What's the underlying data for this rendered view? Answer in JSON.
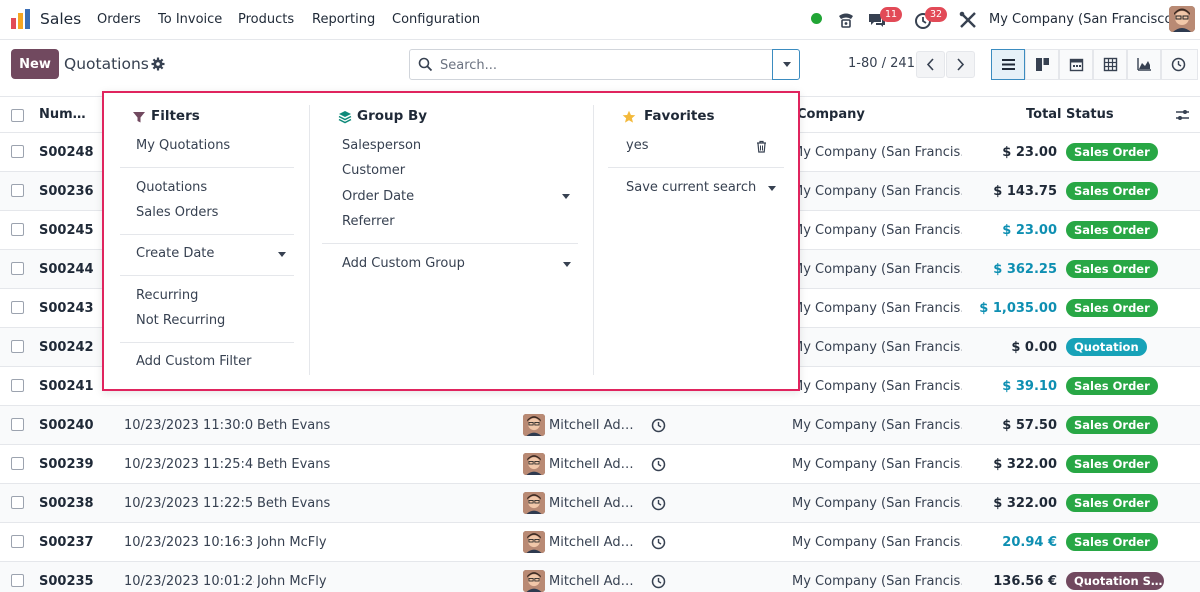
{
  "topnav": {
    "app_name": "Sales",
    "menu": [
      "Orders",
      "To Invoice",
      "Products",
      "Reporting",
      "Configuration"
    ],
    "chat_count": "11",
    "activity_count": "32",
    "company": "My Company (San Francisco)"
  },
  "control": {
    "new_label": "New",
    "title": "Quotations",
    "search_placeholder": "Search...",
    "pager": "1-80 / 241"
  },
  "table": {
    "headers": {
      "number": "Num…",
      "company": "Company",
      "total": "Total",
      "status": "Status"
    },
    "rows": [
      {
        "number": "S00248",
        "date": "",
        "customer": "",
        "salesperson": "",
        "company": "My Company (San Francis…",
        "total": "$ 23.00",
        "total_color": "#1f2937",
        "status": "Sales Order",
        "status_color": "#28a745"
      },
      {
        "number": "S00236",
        "date": "",
        "customer": "",
        "salesperson": "",
        "company": "My Company (San Francis…",
        "total": "$ 143.75",
        "total_color": "#1f2937",
        "status": "Sales Order",
        "status_color": "#28a745"
      },
      {
        "number": "S00245",
        "date": "",
        "customer": "",
        "salesperson": "",
        "company": "My Company (San Francis…",
        "total": "$ 23.00",
        "total_color": "#0e8fb2",
        "status": "Sales Order",
        "status_color": "#28a745"
      },
      {
        "number": "S00244",
        "date": "",
        "customer": "",
        "salesperson": "",
        "company": "My Company (San Francis…",
        "total": "$ 362.25",
        "total_color": "#0e8fb2",
        "status": "Sales Order",
        "status_color": "#28a745"
      },
      {
        "number": "S00243",
        "date": "",
        "customer": "",
        "salesperson": "",
        "company": "My Company (San Francis…",
        "total": "$ 1,035.00",
        "total_color": "#0e8fb2",
        "status": "Sales Order",
        "status_color": "#28a745"
      },
      {
        "number": "S00242",
        "date": "",
        "customer": "",
        "salesperson": "",
        "company": "My Company (San Francis…",
        "total": "$ 0.00",
        "total_color": "#1f2937",
        "status": "Quotation",
        "status_color": "#17a2b8"
      },
      {
        "number": "S00241",
        "date": "",
        "customer": "",
        "salesperson": "",
        "company": "My Company (San Francis…",
        "total": "$ 39.10",
        "total_color": "#0e8fb2",
        "status": "Sales Order",
        "status_color": "#28a745"
      },
      {
        "number": "S00240",
        "date": "10/23/2023 11:30:00",
        "customer": "Beth Evans",
        "salesperson": "Mitchell Ad…",
        "company": "My Company (San Francis…",
        "total": "$ 57.50",
        "total_color": "#1f2937",
        "status": "Sales Order",
        "status_color": "#28a745"
      },
      {
        "number": "S00239",
        "date": "10/23/2023 11:25:41",
        "customer": "Beth Evans",
        "salesperson": "Mitchell Ad…",
        "company": "My Company (San Francis…",
        "total": "$ 322.00",
        "total_color": "#1f2937",
        "status": "Sales Order",
        "status_color": "#28a745"
      },
      {
        "number": "S00238",
        "date": "10/23/2023 11:22:51",
        "customer": "Beth Evans",
        "salesperson": "Mitchell Ad…",
        "company": "My Company (San Francis…",
        "total": "$ 322.00",
        "total_color": "#1f2937",
        "status": "Sales Order",
        "status_color": "#28a745"
      },
      {
        "number": "S00237",
        "date": "10/23/2023 10:16:37",
        "customer": "John McFly",
        "salesperson": "Mitchell Ad…",
        "company": "My Company (San Francis…",
        "total": "20.94 €",
        "total_color": "#0e8fb2",
        "status": "Sales Order",
        "status_color": "#28a745"
      },
      {
        "number": "S00235",
        "date": "10/23/2023 10:01:24",
        "customer": "John McFly",
        "salesperson": "Mitchell Ad…",
        "company": "My Company (San Francis…",
        "total": "136.56 €",
        "total_color": "#1f2937",
        "status": "Quotation S…",
        "status_color": "#71495f"
      }
    ]
  },
  "panel": {
    "filters": {
      "title": "Filters",
      "my_quotations": "My Quotations",
      "quotations": "Quotations",
      "sales_orders": "Sales Orders",
      "create_date": "Create Date",
      "recurring": "Recurring",
      "not_recurring": "Not Recurring",
      "add_custom_filter": "Add Custom Filter"
    },
    "groupby": {
      "title": "Group By",
      "salesperson": "Salesperson",
      "customer": "Customer",
      "order_date": "Order Date",
      "referrer": "Referrer",
      "add_custom_group": "Add Custom Group"
    },
    "favorites": {
      "title": "Favorites",
      "saved": "yes",
      "save_current": "Save current search"
    }
  },
  "colors": {
    "brand": "#71495f",
    "highlight": "#e0245e",
    "online": "#21a535"
  }
}
